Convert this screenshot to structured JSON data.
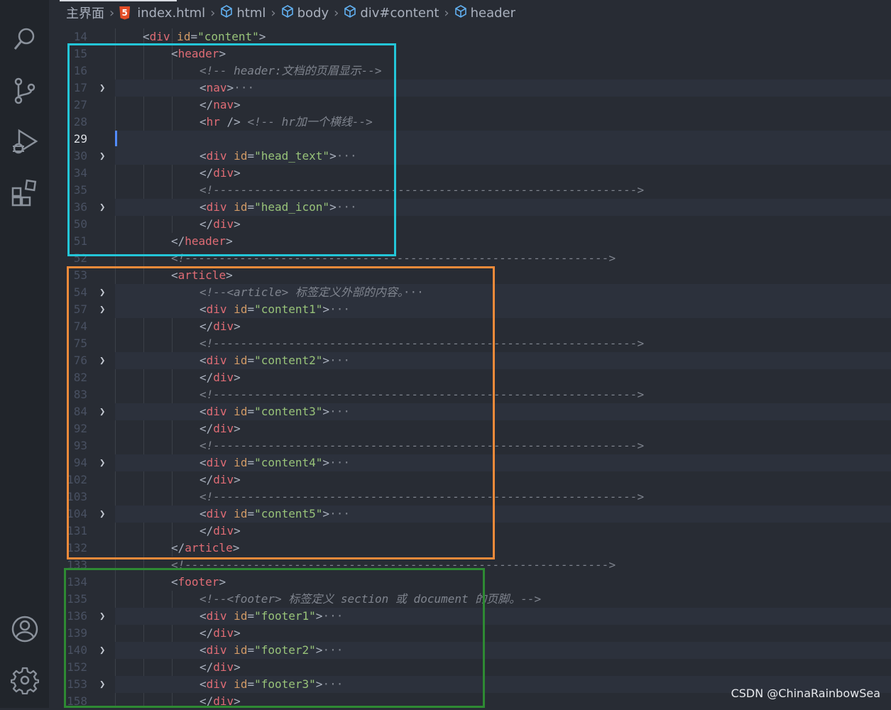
{
  "activity_bar": {
    "icons": [
      "search-icon",
      "source-control-icon",
      "run-debug-icon",
      "extensions-icon",
      "account-icon",
      "settings-gear-icon"
    ]
  },
  "breadcrumb": {
    "root": "主界面",
    "file": "index.html",
    "file_icon": "html5-icon",
    "items": [
      "html",
      "body",
      "div#content",
      "header"
    ]
  },
  "watermark": "CSDN @ChinaRainbowSea",
  "highlights": [
    {
      "label": "header-section",
      "color": "#23c6d8"
    },
    {
      "label": "article-section",
      "color": "#ee8a3a"
    },
    {
      "label": "footer-section",
      "color": "#2e8a33"
    }
  ],
  "code_lines": [
    {
      "n": "14",
      "indent": 1,
      "tokens": [
        [
          "p",
          "<"
        ],
        [
          "t",
          "div"
        ],
        [
          "a",
          " id"
        ],
        [
          "p",
          "="
        ],
        [
          "s",
          "\"content\""
        ],
        [
          "p",
          ">"
        ]
      ]
    },
    {
      "n": "15",
      "indent": 2,
      "tokens": [
        [
          "p",
          "<"
        ],
        [
          "t",
          "header"
        ],
        [
          "p",
          ">"
        ]
      ]
    },
    {
      "n": "16",
      "indent": 3,
      "tokens": [
        [
          "c",
          "<!-- header:文档的页眉显示-->"
        ]
      ]
    },
    {
      "n": "17",
      "indent": 3,
      "fold": true,
      "tokens": [
        [
          "p",
          "<"
        ],
        [
          "t",
          "nav"
        ],
        [
          "p",
          ">"
        ],
        [
          "e",
          "···"
        ]
      ]
    },
    {
      "n": "27",
      "indent": 3,
      "tokens": [
        [
          "p",
          "</"
        ],
        [
          "t",
          "nav"
        ],
        [
          "p",
          ">"
        ]
      ]
    },
    {
      "n": "28",
      "indent": 3,
      "tokens": [
        [
          "p",
          "<"
        ],
        [
          "t",
          "hr"
        ],
        [
          "p",
          " /> "
        ],
        [
          "c",
          "<!-- hr加一个横线-->"
        ]
      ]
    },
    {
      "n": "29",
      "indent": 3,
      "current": true,
      "tokens": []
    },
    {
      "n": "30",
      "indent": 3,
      "fold": true,
      "tokens": [
        [
          "p",
          "<"
        ],
        [
          "t",
          "div"
        ],
        [
          "a",
          " id"
        ],
        [
          "p",
          "="
        ],
        [
          "s",
          "\"head_text\""
        ],
        [
          "p",
          ">"
        ],
        [
          "e",
          "···"
        ]
      ]
    },
    {
      "n": "34",
      "indent": 3,
      "tokens": [
        [
          "p",
          "</"
        ],
        [
          "t",
          "div"
        ],
        [
          "p",
          ">"
        ]
      ]
    },
    {
      "n": "35",
      "indent": 3,
      "tokens": [
        [
          "c",
          "<!-------------------------------------------------------------->"
        ]
      ]
    },
    {
      "n": "36",
      "indent": 3,
      "fold": true,
      "tokens": [
        [
          "p",
          "<"
        ],
        [
          "t",
          "div"
        ],
        [
          "a",
          " id"
        ],
        [
          "p",
          "="
        ],
        [
          "s",
          "\"head_icon\""
        ],
        [
          "p",
          ">"
        ],
        [
          "e",
          "···"
        ]
      ]
    },
    {
      "n": "50",
      "indent": 3,
      "tokens": [
        [
          "p",
          "</"
        ],
        [
          "t",
          "div"
        ],
        [
          "p",
          ">"
        ]
      ]
    },
    {
      "n": "51",
      "indent": 2,
      "tokens": [
        [
          "p",
          "</"
        ],
        [
          "t",
          "header"
        ],
        [
          "p",
          ">"
        ]
      ]
    },
    {
      "n": "52",
      "indent": 2,
      "tokens": [
        [
          "c",
          "<!-------------------------------------------------------------->"
        ]
      ]
    },
    {
      "n": "53",
      "indent": 2,
      "tokens": [
        [
          "p",
          "<"
        ],
        [
          "t",
          "article"
        ],
        [
          "p",
          ">"
        ]
      ]
    },
    {
      "n": "54",
      "indent": 3,
      "fold": true,
      "tokens": [
        [
          "c",
          "<!--<article> 标签定义外部的内容。"
        ],
        [
          "e",
          "···"
        ]
      ]
    },
    {
      "n": "57",
      "indent": 3,
      "fold": true,
      "tokens": [
        [
          "p",
          "<"
        ],
        [
          "t",
          "div"
        ],
        [
          "a",
          " id"
        ],
        [
          "p",
          "="
        ],
        [
          "s",
          "\"content1\""
        ],
        [
          "p",
          ">"
        ],
        [
          "e",
          "···"
        ]
      ]
    },
    {
      "n": "74",
      "indent": 3,
      "tokens": [
        [
          "p",
          "</"
        ],
        [
          "t",
          "div"
        ],
        [
          "p",
          ">"
        ]
      ]
    },
    {
      "n": "75",
      "indent": 3,
      "tokens": [
        [
          "c",
          "<!-------------------------------------------------------------->"
        ]
      ]
    },
    {
      "n": "76",
      "indent": 3,
      "fold": true,
      "tokens": [
        [
          "p",
          "<"
        ],
        [
          "t",
          "div"
        ],
        [
          "a",
          " id"
        ],
        [
          "p",
          "="
        ],
        [
          "s",
          "\"content2\""
        ],
        [
          "p",
          ">"
        ],
        [
          "e",
          "···"
        ]
      ]
    },
    {
      "n": "82",
      "indent": 3,
      "tokens": [
        [
          "p",
          "</"
        ],
        [
          "t",
          "div"
        ],
        [
          "p",
          ">"
        ]
      ]
    },
    {
      "n": "83",
      "indent": 3,
      "tokens": [
        [
          "c",
          "<!-------------------------------------------------------------->"
        ]
      ]
    },
    {
      "n": "84",
      "indent": 3,
      "fold": true,
      "tokens": [
        [
          "p",
          "<"
        ],
        [
          "t",
          "div"
        ],
        [
          "a",
          " id"
        ],
        [
          "p",
          "="
        ],
        [
          "s",
          "\"content3\""
        ],
        [
          "p",
          ">"
        ],
        [
          "e",
          "···"
        ]
      ]
    },
    {
      "n": "92",
      "indent": 3,
      "tokens": [
        [
          "p",
          "</"
        ],
        [
          "t",
          "div"
        ],
        [
          "p",
          ">"
        ]
      ]
    },
    {
      "n": "93",
      "indent": 3,
      "tokens": [
        [
          "c",
          "<!-------------------------------------------------------------->"
        ]
      ]
    },
    {
      "n": "94",
      "indent": 3,
      "fold": true,
      "tokens": [
        [
          "p",
          "<"
        ],
        [
          "t",
          "div"
        ],
        [
          "a",
          " id"
        ],
        [
          "p",
          "="
        ],
        [
          "s",
          "\"content4\""
        ],
        [
          "p",
          ">"
        ],
        [
          "e",
          "···"
        ]
      ]
    },
    {
      "n": "102",
      "indent": 3,
      "tokens": [
        [
          "p",
          "</"
        ],
        [
          "t",
          "div"
        ],
        [
          "p",
          ">"
        ]
      ]
    },
    {
      "n": "103",
      "indent": 3,
      "tokens": [
        [
          "c",
          "<!-------------------------------------------------------------->"
        ]
      ]
    },
    {
      "n": "104",
      "indent": 3,
      "fold": true,
      "tokens": [
        [
          "p",
          "<"
        ],
        [
          "t",
          "div"
        ],
        [
          "a",
          " id"
        ],
        [
          "p",
          "="
        ],
        [
          "s",
          "\"content5\""
        ],
        [
          "p",
          ">"
        ],
        [
          "e",
          "···"
        ]
      ]
    },
    {
      "n": "131",
      "indent": 3,
      "tokens": [
        [
          "p",
          "</"
        ],
        [
          "t",
          "div"
        ],
        [
          "p",
          ">"
        ]
      ]
    },
    {
      "n": "132",
      "indent": 2,
      "tokens": [
        [
          "p",
          "</"
        ],
        [
          "t",
          "article"
        ],
        [
          "p",
          ">"
        ]
      ]
    },
    {
      "n": "133",
      "indent": 2,
      "tokens": [
        [
          "c",
          "<!-------------------------------------------------------------->"
        ]
      ]
    },
    {
      "n": "134",
      "indent": 2,
      "tokens": [
        [
          "p",
          "<"
        ],
        [
          "t",
          "footer"
        ],
        [
          "p",
          ">"
        ]
      ]
    },
    {
      "n": "135",
      "indent": 3,
      "tokens": [
        [
          "c",
          "<!--<footer> 标签定义 section 或 document 的页脚。-->"
        ]
      ]
    },
    {
      "n": "136",
      "indent": 3,
      "fold": true,
      "tokens": [
        [
          "p",
          "<"
        ],
        [
          "t",
          "div"
        ],
        [
          "a",
          " id"
        ],
        [
          "p",
          "="
        ],
        [
          "s",
          "\"footer1\""
        ],
        [
          "p",
          ">"
        ],
        [
          "e",
          "···"
        ]
      ]
    },
    {
      "n": "139",
      "indent": 3,
      "tokens": [
        [
          "p",
          "</"
        ],
        [
          "t",
          "div"
        ],
        [
          "p",
          ">"
        ]
      ]
    },
    {
      "n": "140",
      "indent": 3,
      "fold": true,
      "tokens": [
        [
          "p",
          "<"
        ],
        [
          "t",
          "div"
        ],
        [
          "a",
          " id"
        ],
        [
          "p",
          "="
        ],
        [
          "s",
          "\"footer2\""
        ],
        [
          "p",
          ">"
        ],
        [
          "e",
          "···"
        ]
      ]
    },
    {
      "n": "152",
      "indent": 3,
      "tokens": [
        [
          "p",
          "</"
        ],
        [
          "t",
          "div"
        ],
        [
          "p",
          ">"
        ]
      ]
    },
    {
      "n": "153",
      "indent": 3,
      "fold": true,
      "tokens": [
        [
          "p",
          "<"
        ],
        [
          "t",
          "div"
        ],
        [
          "a",
          " id"
        ],
        [
          "p",
          "="
        ],
        [
          "s",
          "\"footer3\""
        ],
        [
          "p",
          ">"
        ],
        [
          "e",
          "···"
        ]
      ]
    },
    {
      "n": "158",
      "indent": 3,
      "tokens": [
        [
          "p",
          "</"
        ],
        [
          "t",
          "div"
        ],
        [
          "p",
          ">"
        ]
      ]
    }
  ]
}
